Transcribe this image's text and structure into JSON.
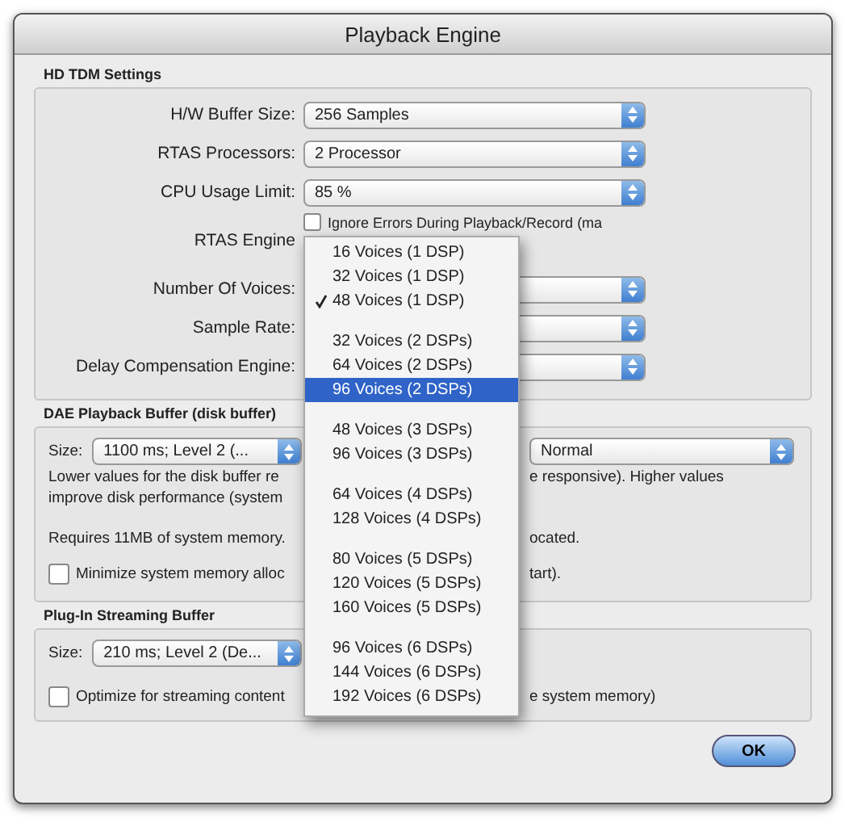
{
  "window": {
    "title": "Playback Engine"
  },
  "hd_tdm_settings": {
    "title": "HD TDM Settings",
    "rows": [
      {
        "kind": "popup",
        "label": "H/W Buffer Size:",
        "value": "256 Samples"
      },
      {
        "kind": "popup",
        "label": "RTAS Processors:",
        "value": "2 Processor"
      },
      {
        "kind": "popup",
        "label": "CPU Usage Limit:",
        "value": "85 %"
      },
      {
        "kind": "checkbox",
        "label": "RTAS Engine",
        "text": "Ignore Errors During Playback/Record (ma",
        "checked": false
      },
      {
        "kind": "popup",
        "label": "Number Of Voices:"
      },
      {
        "kind": "popup",
        "label": "Sample Rate:"
      },
      {
        "kind": "popup",
        "label": "Delay Compensation Engine:"
      }
    ]
  },
  "dae_playback_buffer": {
    "title": "DAE Playback Buffer (disk buffer)",
    "size_label": "Size:",
    "size_value": "1100 ms; Level 2 (...",
    "right_popup_value": "Normal",
    "notes": [
      {
        "left": "Lower values for the disk buffer re",
        "right": "e responsive).  Higher values"
      },
      {
        "left": "improve disk performance (system"
      },
      {
        "left": "Requires 11MB of system memory.",
        "right": "ocated."
      }
    ],
    "checkbox": {
      "left": "Minimize system memory alloc",
      "right": "tart).",
      "checked": false
    }
  },
  "plugin_streaming_buffer": {
    "title": "Plug-In Streaming Buffer",
    "size_label": "Size:",
    "size_value": "210 ms; Level 2 (De...",
    "checkbox": {
      "left": "Optimize for streaming content",
      "right": "e system memory)",
      "checked": false
    }
  },
  "voices_menu": {
    "groups": [
      [
        {
          "label": "16 Voices (1 DSP)",
          "checked": false,
          "selected": false
        },
        {
          "label": "32 Voices (1 DSP)",
          "checked": false,
          "selected": false
        },
        {
          "label": "48 Voices (1 DSP)",
          "checked": true,
          "selected": false
        }
      ],
      [
        {
          "label": "32 Voices (2 DSPs)",
          "checked": false,
          "selected": false
        },
        {
          "label": "64 Voices (2 DSPs)",
          "checked": false,
          "selected": false
        },
        {
          "label": "96 Voices (2 DSPs)",
          "checked": false,
          "selected": true
        }
      ],
      [
        {
          "label": "48 Voices (3 DSPs)",
          "checked": false,
          "selected": false
        },
        {
          "label": "96 Voices (3 DSPs)",
          "checked": false,
          "selected": false
        }
      ],
      [
        {
          "label": "64 Voices (4 DSPs)",
          "checked": false,
          "selected": false
        },
        {
          "label": "128 Voices (4 DSPs)",
          "checked": false,
          "selected": false
        }
      ],
      [
        {
          "label": "80 Voices (5 DSPs)",
          "checked": false,
          "selected": false
        },
        {
          "label": "120 Voices (5 DSPs)",
          "checked": false,
          "selected": false
        },
        {
          "label": "160 Voices (5 DSPs)",
          "checked": false,
          "selected": false
        }
      ],
      [
        {
          "label": "96 Voices (6 DSPs)",
          "checked": false,
          "selected": false
        },
        {
          "label": "144 Voices (6 DSPs)",
          "checked": false,
          "selected": false
        },
        {
          "label": "192 Voices (6 DSPs)",
          "checked": false,
          "selected": false
        }
      ]
    ]
  },
  "buttons": [
    {
      "label": "OK",
      "default": true
    }
  ]
}
